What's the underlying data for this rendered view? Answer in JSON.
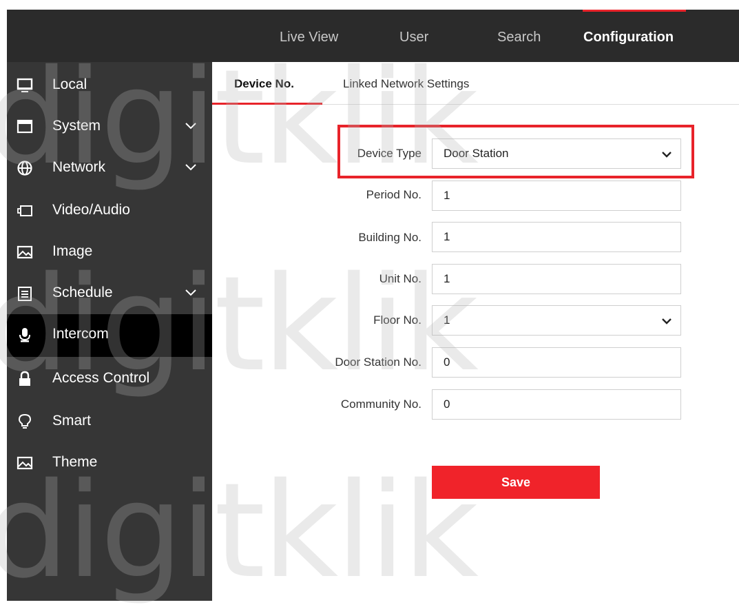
{
  "header": {
    "nav": [
      {
        "label": "Live View",
        "active": false
      },
      {
        "label": "User",
        "active": false
      },
      {
        "label": "Search",
        "active": false
      },
      {
        "label": "Configuration",
        "active": true
      }
    ]
  },
  "sidebar": {
    "items": [
      {
        "label": "Local",
        "icon": "monitor-icon",
        "expandable": false
      },
      {
        "label": "System",
        "icon": "window-icon",
        "expandable": true
      },
      {
        "label": "Network",
        "icon": "globe-icon",
        "expandable": true
      },
      {
        "label": "Video/Audio",
        "icon": "video-icon",
        "expandable": false
      },
      {
        "label": "Image",
        "icon": "image-icon",
        "expandable": false
      },
      {
        "label": "Schedule",
        "icon": "calendar-icon",
        "expandable": true
      },
      {
        "label": "Intercom",
        "icon": "microphone-icon",
        "expandable": false,
        "active": true
      },
      {
        "label": "Access Control",
        "icon": "lock-icon",
        "expandable": false
      },
      {
        "label": "Smart",
        "icon": "lightbulb-icon",
        "expandable": false
      },
      {
        "label": "Theme",
        "icon": "image-icon",
        "expandable": false
      }
    ]
  },
  "tabs": [
    {
      "label": "Device No.",
      "active": true
    },
    {
      "label": "Linked Network Settings",
      "active": false
    }
  ],
  "form": {
    "device_type": {
      "label": "Device Type",
      "value": "Door Station"
    },
    "period_no": {
      "label": "Period No.",
      "value": "1"
    },
    "building_no": {
      "label": "Building No.",
      "value": "1"
    },
    "unit_no": {
      "label": "Unit No.",
      "value": "1"
    },
    "floor_no": {
      "label": "Floor No.",
      "value": "1"
    },
    "door_station_no": {
      "label": "Door Station No.",
      "value": "0"
    },
    "community_no": {
      "label": "Community No.",
      "value": "0"
    },
    "save_label": "Save"
  },
  "watermark": "digitklik",
  "colors": {
    "accent": "#e8232a",
    "header_bg": "#2b2b2b",
    "sidebar_bg": "#363636",
    "sidebar_active_bg": "#000000"
  }
}
